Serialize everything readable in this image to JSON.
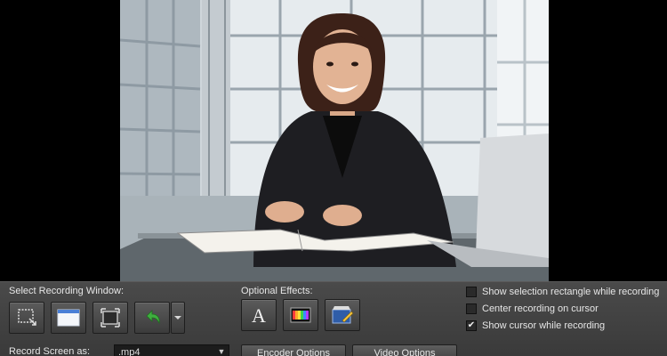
{
  "recording_window": {
    "label": "Select Recording Window:",
    "buttons": [
      {
        "name": "select-region-icon"
      },
      {
        "name": "window-capture-icon"
      },
      {
        "name": "fullscreen-icon"
      },
      {
        "name": "previous-region-icon"
      },
      {
        "name": "chevron-down-icon"
      }
    ]
  },
  "effects": {
    "label": "Optional Effects:",
    "buttons": [
      {
        "name": "text-effect-icon"
      },
      {
        "name": "color-effect-icon"
      },
      {
        "name": "video-effect-icon"
      }
    ]
  },
  "options": [
    {
      "label": "Show selection rectangle while recording",
      "checked": false
    },
    {
      "label": "Center recording on cursor",
      "checked": false
    },
    {
      "label": "Show cursor while recording",
      "checked": true
    }
  ],
  "record_as": {
    "label": "Record Screen as:",
    "value": ".mp4"
  },
  "buttons": {
    "encoder": "Encoder Options",
    "video": "Video Options"
  },
  "checkmark": "✔",
  "colors": {
    "panel": "#3d3d3d",
    "preview_bg": "#000000",
    "suit": "#1e1e22"
  }
}
